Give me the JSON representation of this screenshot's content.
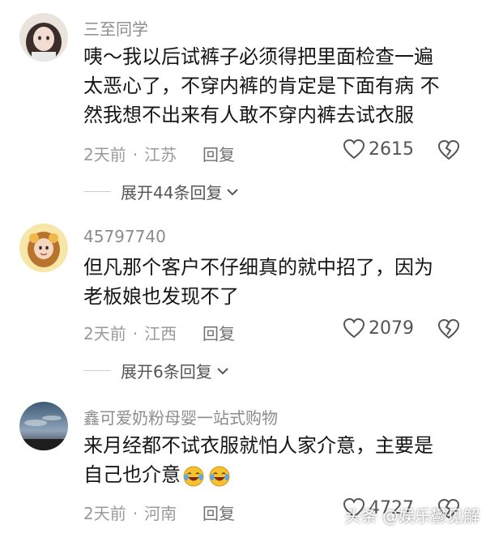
{
  "comments": [
    {
      "username": "三至同学",
      "text": "咦～我以后试裤子必须得把里面检查一遍\n太恶心了，不穿内裤的肯定是下面有病 不\n然我想不出来有人敢不穿内裤去试衣服",
      "time": "2天前",
      "location": "江苏",
      "reply_label": "回复",
      "likes": "2615",
      "expand_label": "展开44条回复"
    },
    {
      "username": "45797740",
      "text": "但凡那个客户不仔细真的就中招了，因为\n老板娘也发现不了",
      "time": "2天前",
      "location": "江西",
      "reply_label": "回复",
      "likes": "2079",
      "expand_label": "展开6条回复"
    },
    {
      "username": "鑫可爱奶粉母婴一站式购物",
      "text": "来月经都不试衣服就怕人家介意，主要是\n自己也介意",
      "time": "2天前",
      "location": "河南",
      "reply_label": "回复",
      "likes": "4727"
    }
  ],
  "watermark": "头条 @娱乐鬱见解",
  "icons": {
    "like": "heart-outline-icon",
    "dislike": "broken-heart-icon",
    "expand": "chevron-down-icon",
    "emoji": "laughing-tears-emoji"
  },
  "colors": {
    "text": "#161616",
    "meta": "#9a9a9a",
    "username": "#8c8c8c",
    "icon": "#555555"
  }
}
